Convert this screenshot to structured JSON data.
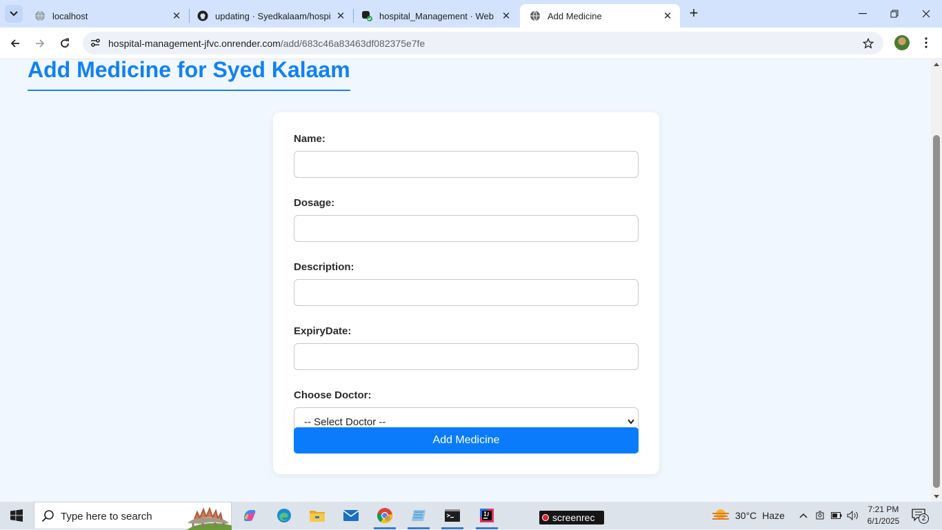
{
  "browser": {
    "tabs": [
      {
        "title": "localhost",
        "icon": "globe-icon"
      },
      {
        "title": "updating · Syedkalaam/hospital_Management",
        "icon": "github-icon"
      },
      {
        "title": "hospital_Management · Web Service",
        "icon": "render-icon"
      },
      {
        "title": "Add Medicine",
        "icon": "globe-icon"
      }
    ],
    "url_host": "hospital-management-jfvc.onrender.com",
    "url_path": "/add/683c46a83463df082375e7fe"
  },
  "page": {
    "heading": "Add Medicine for Syed Kalaam",
    "fields": [
      {
        "label": "Name:",
        "value": ""
      },
      {
        "label": "Dosage:",
        "value": ""
      },
      {
        "label": "Description:",
        "value": ""
      },
      {
        "label": "ExpiryDate:",
        "value": ""
      }
    ],
    "doctor_label": "Choose Doctor:",
    "doctor_selected": "-- Select Doctor --",
    "submit_label": "Add Medicine",
    "accent_color": "#1181f2",
    "button_color": "#0a7cfb"
  },
  "taskbar": {
    "search_placeholder": "Type here to search",
    "screenrec_label": "screenrec",
    "weather_temp": "30°C",
    "weather_desc": "Haze",
    "time": "7:21 PM",
    "date": "6/1/2025",
    "notification_count": "2"
  }
}
